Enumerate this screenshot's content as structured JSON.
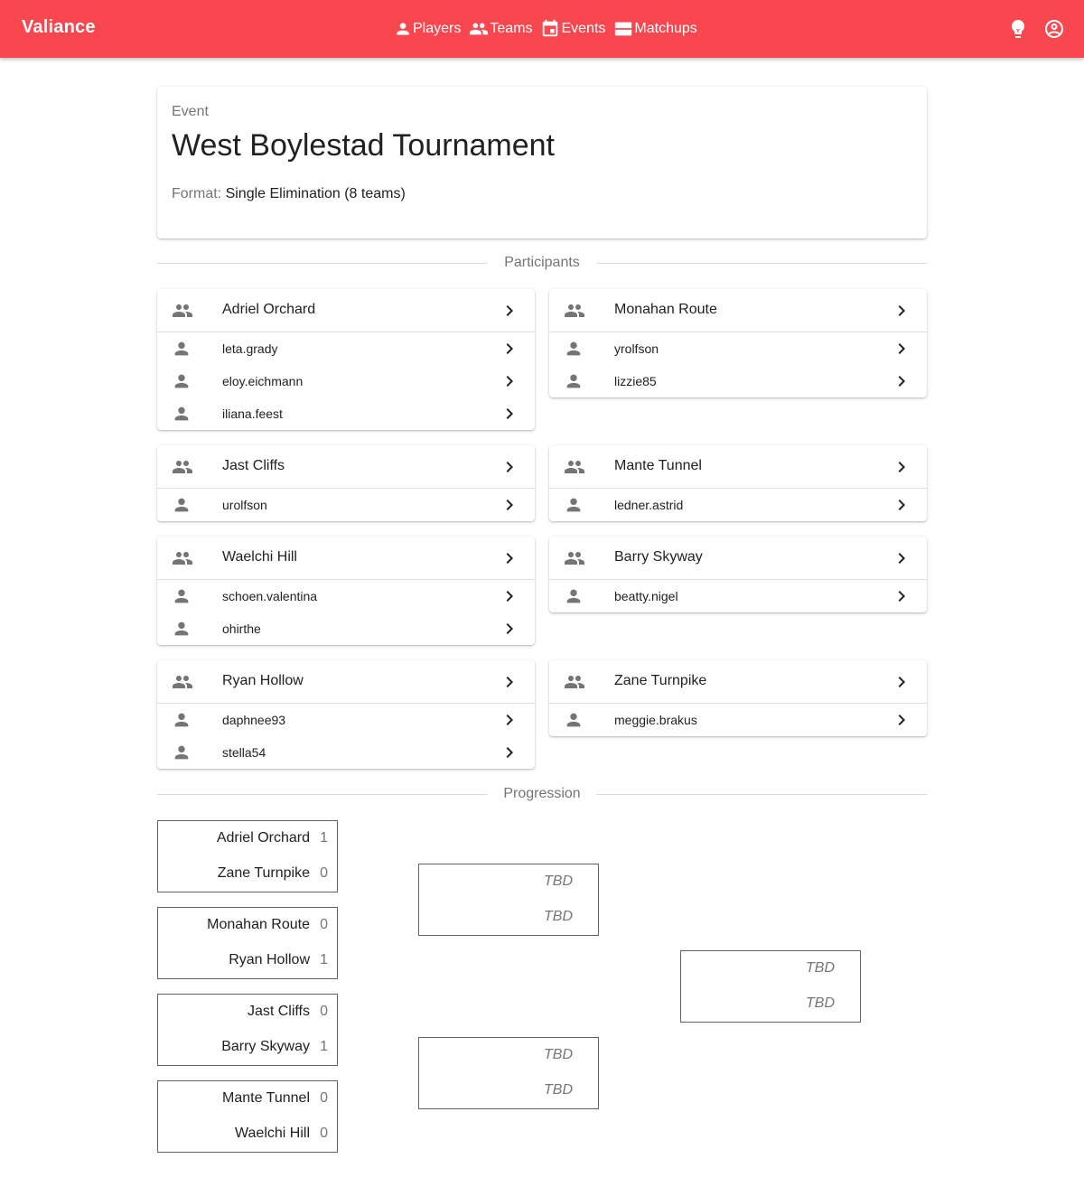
{
  "app": {
    "brand": "Valiance"
  },
  "nav": {
    "players": "Players",
    "teams": "Teams",
    "events": "Events",
    "matchups": "Matchups"
  },
  "event": {
    "overline": "Event",
    "title": "West Boylestad Tournament",
    "format_label": "Format:",
    "format_value": "Single Elimination (8 teams)"
  },
  "sections": {
    "participants": "Participants",
    "progression": "Progression"
  },
  "teams": [
    {
      "name": "Adriel Orchard",
      "members": [
        "leta.grady",
        "eloy.eichmann",
        "iliana.feest"
      ]
    },
    {
      "name": "Monahan Route",
      "members": [
        "yrolfson",
        "lizzie85"
      ]
    },
    {
      "name": "Jast Cliffs",
      "members": [
        "urolfson"
      ]
    },
    {
      "name": "Mante Tunnel",
      "members": [
        "ledner.astrid"
      ]
    },
    {
      "name": "Waelchi Hill",
      "members": [
        "schoen.valentina",
        "ohirthe"
      ]
    },
    {
      "name": "Barry Skyway",
      "members": [
        "beatty.nigel"
      ]
    },
    {
      "name": "Ryan Hollow",
      "members": [
        "daphnee93",
        "stella54"
      ]
    },
    {
      "name": "Zane Turnpike",
      "members": [
        "meggie.brakus"
      ]
    }
  ],
  "bracket": {
    "round1": [
      {
        "a": "Adriel Orchard",
        "a_score": "1",
        "b": "Zane Turnpike",
        "b_score": "0"
      },
      {
        "a": "Monahan Route",
        "a_score": "0",
        "b": "Ryan Hollow",
        "b_score": "1"
      },
      {
        "a": "Jast Cliffs",
        "a_score": "0",
        "b": "Barry Skyway",
        "b_score": "1"
      },
      {
        "a": "Mante Tunnel",
        "a_score": "0",
        "b": "Waelchi Hill",
        "b_score": "0"
      }
    ],
    "round2": [
      {
        "a": "TBD",
        "b": "TBD"
      },
      {
        "a": "TBD",
        "b": "TBD"
      }
    ],
    "final": [
      {
        "a": "TBD",
        "b": "TBD"
      }
    ]
  },
  "icons": {
    "players": "person-icon",
    "teams": "people-icon",
    "events": "calendar-icon",
    "matchups": "matchups-icon",
    "theme": "lightbulb-icon",
    "account": "account-circle-icon",
    "chevron": "chevron-right-icon"
  },
  "colors": {
    "appbar": "#f9474f"
  }
}
